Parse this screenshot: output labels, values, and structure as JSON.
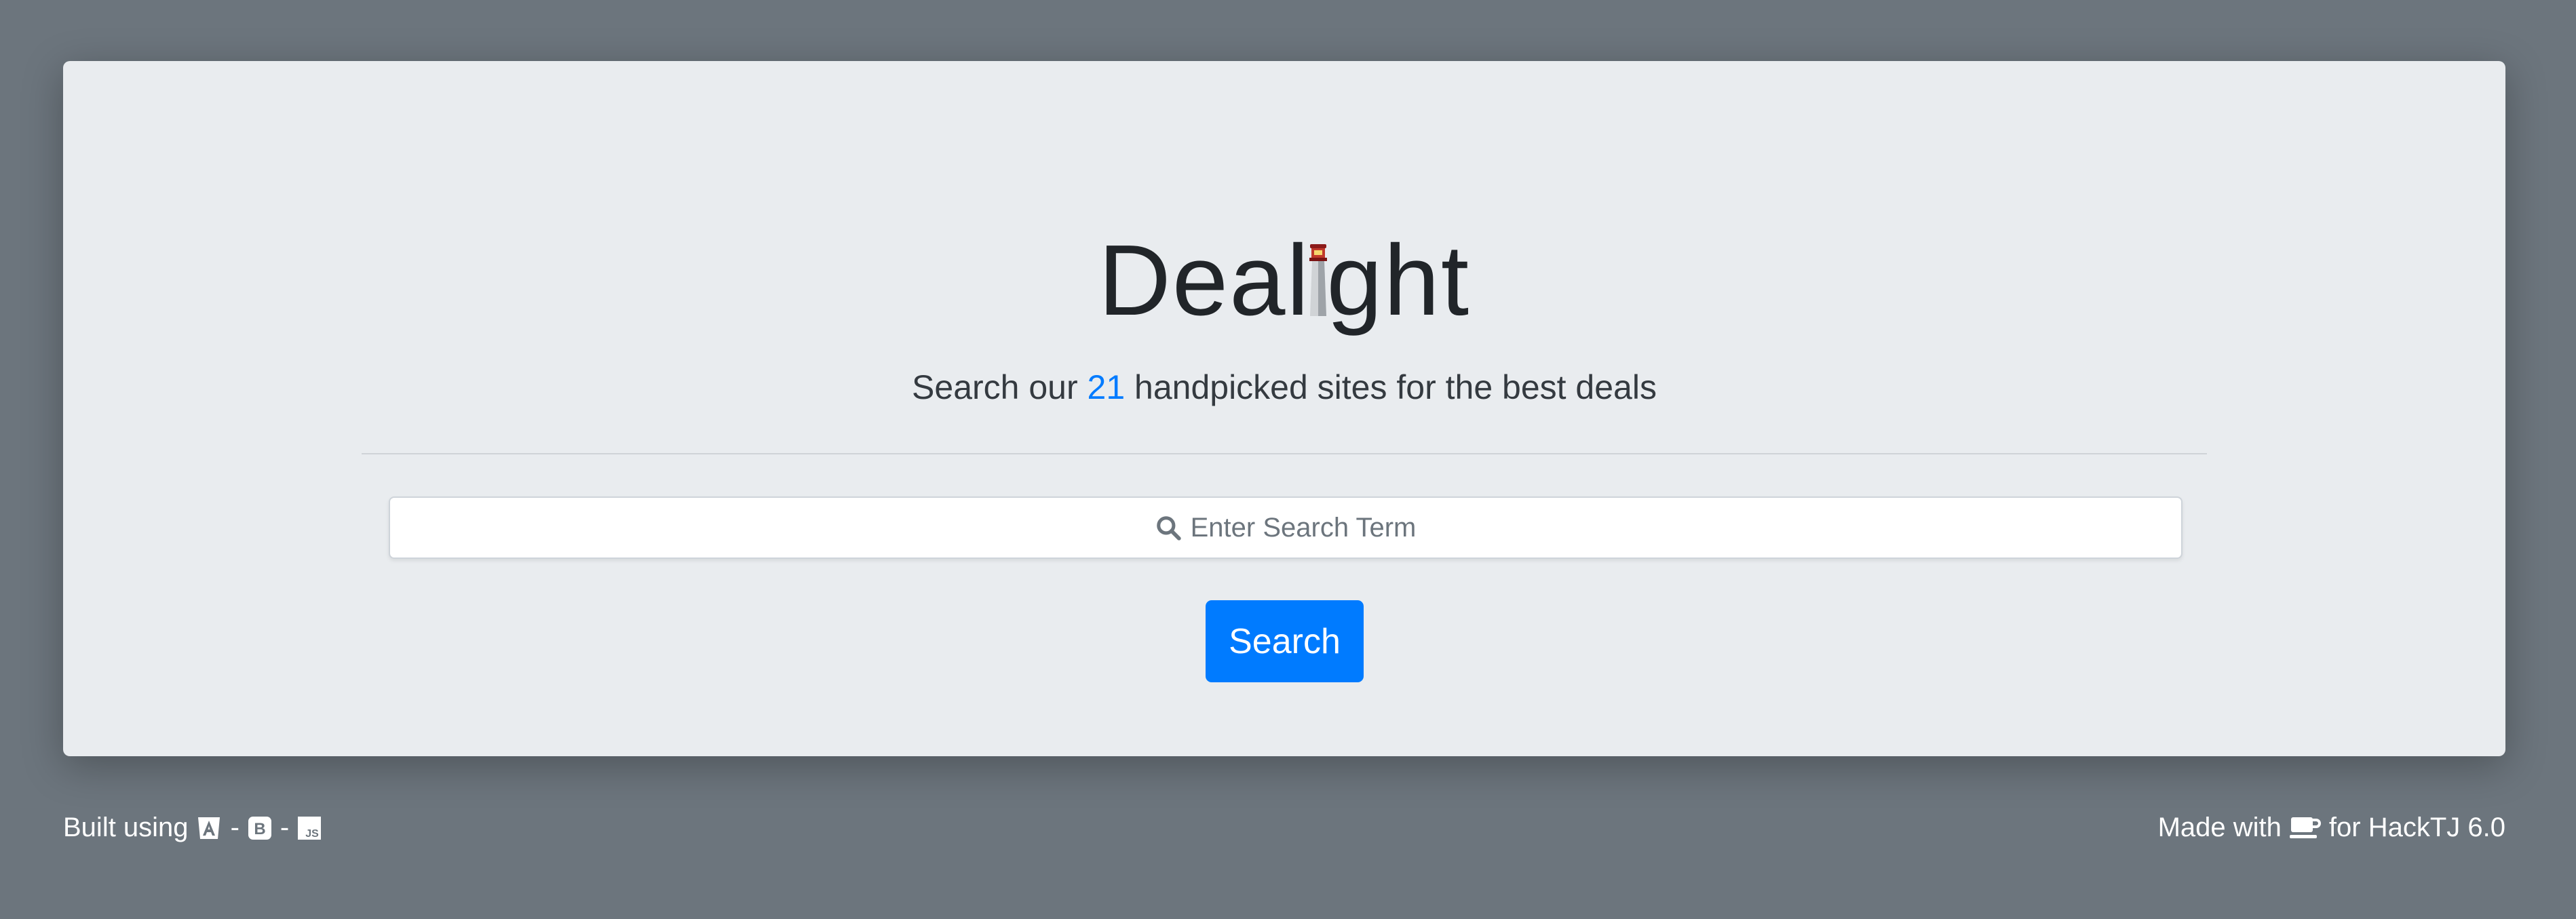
{
  "brand": {
    "title_before": "Deal",
    "title_after": "ght",
    "logo_icon": "lighthouse-icon"
  },
  "subtitle": {
    "prefix": "Search our ",
    "count": "21",
    "suffix": " handpicked sites for the best deals"
  },
  "search": {
    "placeholder": "Enter Search Term",
    "icon": "search-icon",
    "button_label": "Search"
  },
  "footer": {
    "built_prefix": "Built using",
    "sep": "-",
    "built_icons": [
      "angular-icon",
      "bootstrap-icon",
      "js-icon"
    ],
    "made_prefix": "Made with",
    "made_icon": "coffee-icon",
    "made_suffix": "for HackTJ 6.0"
  },
  "colors": {
    "background": "#6c757d",
    "card": "#e9ecef",
    "accent": "#007bff"
  }
}
